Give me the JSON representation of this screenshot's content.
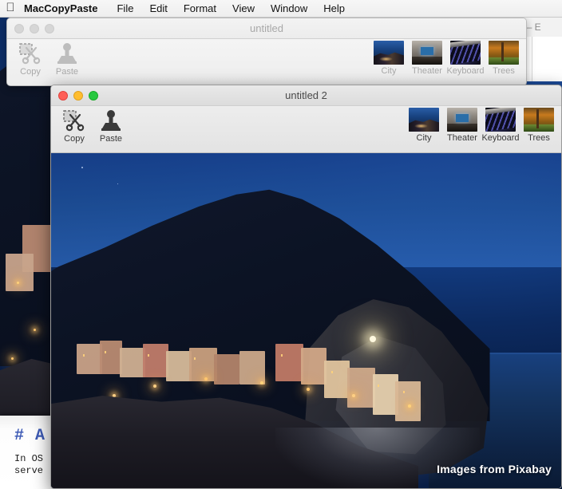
{
  "menubar": {
    "apple_icon": "apple-logo-icon",
    "app_name": "MacCopyPaste",
    "items": [
      "File",
      "Edit",
      "Format",
      "View",
      "Window",
      "Help"
    ]
  },
  "background_editor": {
    "title": "x.md — E"
  },
  "background_document": {
    "heading": "# A",
    "line1": "In OS",
    "line2": "serve"
  },
  "back_window": {
    "title": "untitled",
    "traffic_lights": [
      "close-button",
      "minimize-button",
      "zoom-button"
    ],
    "tools": [
      {
        "label": "Copy",
        "icon": "copy-scissors-icon"
      },
      {
        "label": "Paste",
        "icon": "paste-stamp-icon"
      }
    ],
    "thumbnails": [
      {
        "label": "City",
        "icon": "city-thumbnail"
      },
      {
        "label": "Theater",
        "icon": "theater-thumbnail"
      },
      {
        "label": "Keyboard",
        "icon": "keyboard-thumbnail"
      },
      {
        "label": "Trees",
        "icon": "trees-thumbnail"
      }
    ]
  },
  "front_window": {
    "title": "untitled 2",
    "traffic_lights": [
      "close-button",
      "minimize-button",
      "zoom-button"
    ],
    "tools": [
      {
        "label": "Copy",
        "icon": "copy-scissors-icon"
      },
      {
        "label": "Paste",
        "icon": "paste-stamp-icon"
      }
    ],
    "thumbnails": [
      {
        "label": "City",
        "icon": "city-thumbnail"
      },
      {
        "label": "Theater",
        "icon": "theater-thumbnail"
      },
      {
        "label": "Keyboard",
        "icon": "keyboard-thumbnail"
      },
      {
        "label": "Trees",
        "icon": "trees-thumbnail"
      }
    ],
    "photo": {
      "watermark": "Images from Pixabay",
      "subject": "coastal-village-at-night"
    }
  },
  "colors": {
    "accent_blue": "#1b4fa8",
    "traffic_red": "#ff5f57",
    "traffic_yellow": "#ffbd2e",
    "traffic_green": "#28c840",
    "sky": "#1d4c9a",
    "lamp": "#ffc66e"
  }
}
